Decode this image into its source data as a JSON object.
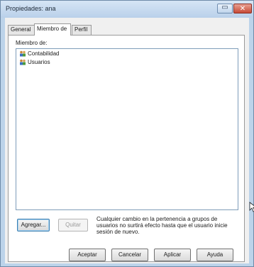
{
  "window": {
    "title": "Propiedades: ana",
    "minimize_glyph": "▭",
    "close_glyph": "✕"
  },
  "tabs": [
    {
      "label": "General",
      "active": false
    },
    {
      "label": "Miembro de",
      "active": true
    },
    {
      "label": "Perfil",
      "active": false
    }
  ],
  "member_of": {
    "label": "Miembro de:",
    "items": [
      {
        "label": "Contabilidad",
        "icon": "group-icon"
      },
      {
        "label": "Usuarios",
        "icon": "group-icon"
      }
    ]
  },
  "actions": {
    "add_label": "Agregar...",
    "remove_label": "Quitar",
    "note": "Cualquier cambio en la pertenencia a grupos de usuarios no surtirá efecto hasta que el usuario inicie sesión de nuevo."
  },
  "footer": {
    "ok_label": "Aceptar",
    "cancel_label": "Cancelar",
    "apply_label": "Aplicar",
    "help_label": "Ayuda"
  },
  "colors": {
    "frame": "#bcd3ea",
    "close_button": "#c74a36",
    "default_button_border": "#3c7fb1"
  }
}
